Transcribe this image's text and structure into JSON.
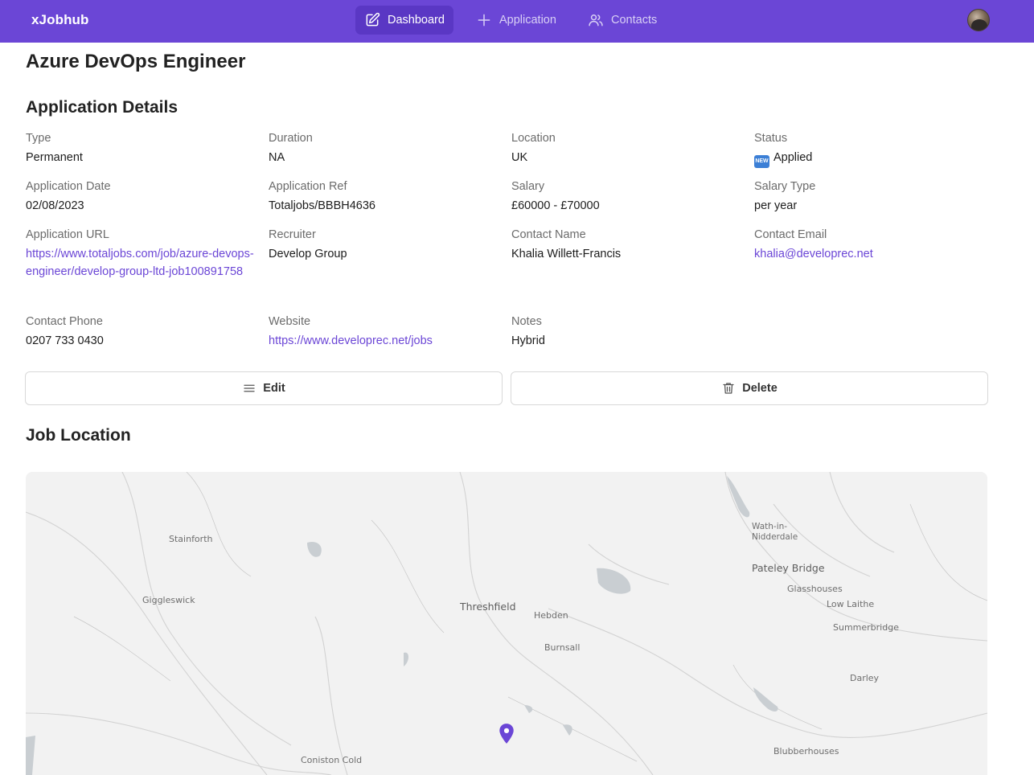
{
  "nav": {
    "brand": "xJobhub",
    "items": [
      {
        "label": "Dashboard",
        "icon": "edit-icon",
        "active": true
      },
      {
        "label": "Application",
        "icon": "plus-icon",
        "active": false
      },
      {
        "label": "Contacts",
        "icon": "users-icon",
        "active": false
      }
    ]
  },
  "page": {
    "title": "Azure DevOps Engineer",
    "details_heading": "Application Details",
    "location_heading": "Job Location"
  },
  "details": {
    "type": {
      "label": "Type",
      "value": "Permanent"
    },
    "duration": {
      "label": "Duration",
      "value": "NA"
    },
    "location": {
      "label": "Location",
      "value": "UK"
    },
    "status": {
      "label": "Status",
      "badge": "NEW",
      "value": "Applied"
    },
    "application_date": {
      "label": "Application Date",
      "value": "02/08/2023"
    },
    "application_ref": {
      "label": "Application Ref",
      "value": "Totaljobs/BBBH4636"
    },
    "salary": {
      "label": "Salary",
      "value": "£60000 - £70000"
    },
    "salary_type": {
      "label": "Salary Type",
      "value": "per year"
    },
    "application_url": {
      "label": "Application URL",
      "value": "https://www.totaljobs.com/job/azure-devops-engineer/develop-group-ltd-job100891758"
    },
    "recruiter": {
      "label": "Recruiter",
      "value": "Develop Group"
    },
    "contact_name": {
      "label": "Contact Name",
      "value": "Khalia Willett-Francis"
    },
    "contact_email": {
      "label": "Contact Email",
      "value": "khalia@developrec.net"
    },
    "contact_phone": {
      "label": "Contact Phone",
      "value": "0207 733 0430"
    },
    "website": {
      "label": "Website",
      "value": "https://www.developrec.net/jobs"
    },
    "notes": {
      "label": "Notes",
      "value": "Hybrid"
    }
  },
  "actions": {
    "edit_label": "Edit",
    "delete_label": "Delete"
  },
  "map": {
    "places": {
      "stainforth": "Stainforth",
      "giggleswick": "Giggleswick",
      "threshfield": "Threshfield",
      "hebden": "Hebden",
      "burnsall": "Burnsall",
      "wath_line1": "Wath-in-",
      "wath_line2": "Nidderdale",
      "pateley_bridge": "Pateley Bridge",
      "glasshouses": "Glasshouses",
      "low_laithe": "Low Laithe",
      "summerbridge": "Summerbridge",
      "darley": "Darley",
      "coniston_cold": "Coniston Cold",
      "blubberhouses": "Blubberhouses"
    },
    "accent_color": "#6b46d6"
  }
}
